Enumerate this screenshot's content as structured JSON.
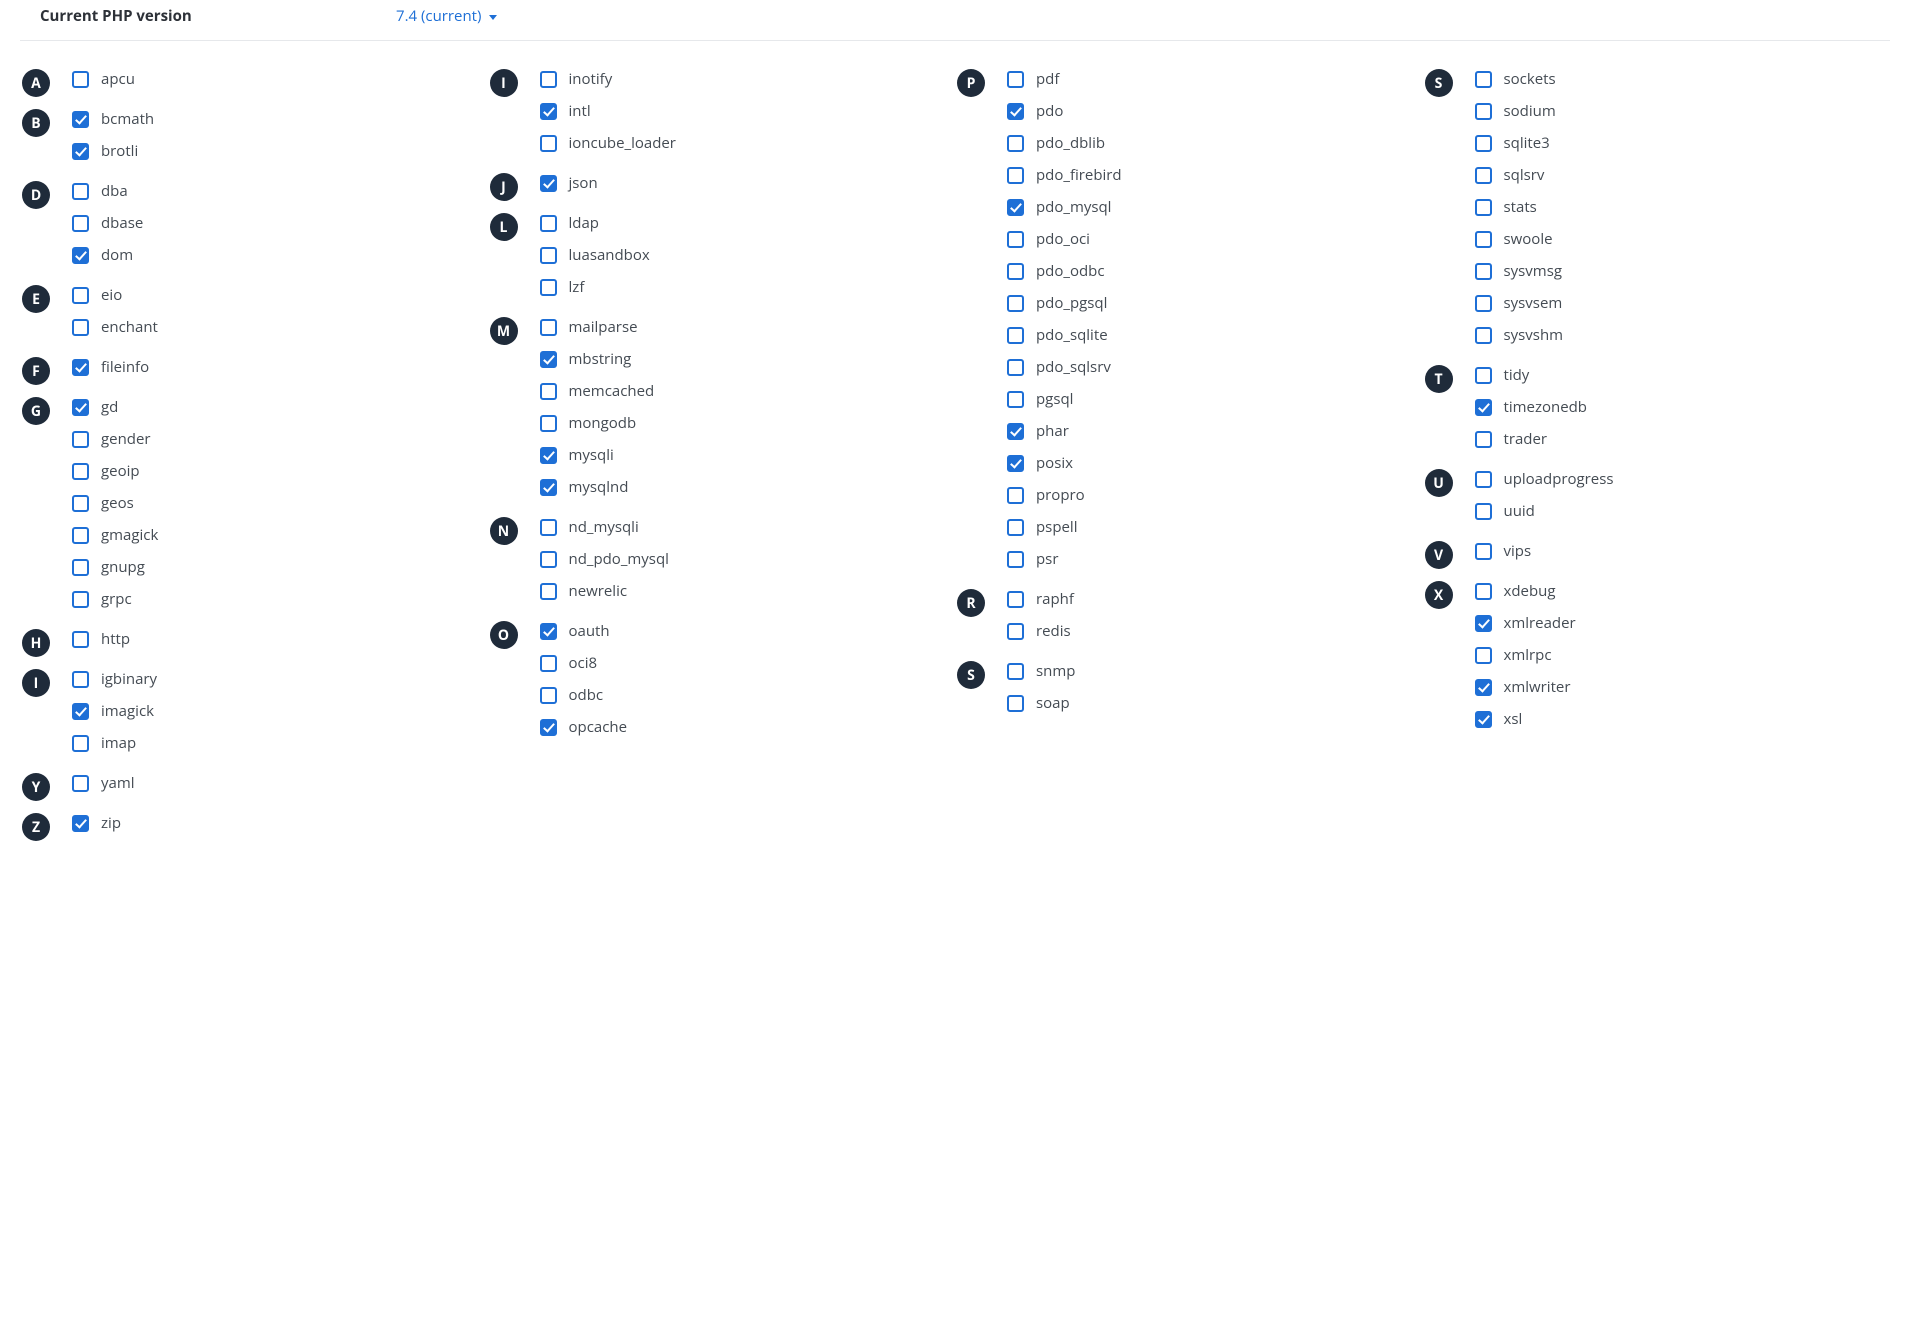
{
  "header": {
    "label": "Current PHP version",
    "version": "7.4 (current)"
  },
  "columns": [
    [
      {
        "letter": "A",
        "items": [
          {
            "name": "apcu",
            "checked": false
          }
        ]
      },
      {
        "letter": "B",
        "items": [
          {
            "name": "bcmath",
            "checked": true
          },
          {
            "name": "brotli",
            "checked": true
          }
        ]
      },
      {
        "letter": "D",
        "items": [
          {
            "name": "dba",
            "checked": false
          },
          {
            "name": "dbase",
            "checked": false
          },
          {
            "name": "dom",
            "checked": true
          }
        ]
      },
      {
        "letter": "E",
        "items": [
          {
            "name": "eio",
            "checked": false
          },
          {
            "name": "enchant",
            "checked": false
          }
        ]
      },
      {
        "letter": "F",
        "items": [
          {
            "name": "fileinfo",
            "checked": true
          }
        ]
      },
      {
        "letter": "G",
        "items": [
          {
            "name": "gd",
            "checked": true
          },
          {
            "name": "gender",
            "checked": false
          },
          {
            "name": "geoip",
            "checked": false
          },
          {
            "name": "geos",
            "checked": false
          },
          {
            "name": "gmagick",
            "checked": false
          },
          {
            "name": "gnupg",
            "checked": false
          },
          {
            "name": "grpc",
            "checked": false
          }
        ]
      },
      {
        "letter": "H",
        "items": [
          {
            "name": "http",
            "checked": false
          }
        ]
      },
      {
        "letter": "I",
        "items": [
          {
            "name": "igbinary",
            "checked": false
          },
          {
            "name": "imagick",
            "checked": true
          },
          {
            "name": "imap",
            "checked": false
          }
        ]
      },
      {
        "letter": "Y",
        "items": [
          {
            "name": "yaml",
            "checked": false
          }
        ]
      },
      {
        "letter": "Z",
        "items": [
          {
            "name": "zip",
            "checked": true
          }
        ]
      }
    ],
    [
      {
        "letter": "I",
        "items": [
          {
            "name": "inotify",
            "checked": false
          },
          {
            "name": "intl",
            "checked": true
          },
          {
            "name": "ioncube_loader",
            "checked": false
          }
        ]
      },
      {
        "letter": "J",
        "items": [
          {
            "name": "json",
            "checked": true
          }
        ]
      },
      {
        "letter": "L",
        "items": [
          {
            "name": "ldap",
            "checked": false
          },
          {
            "name": "luasandbox",
            "checked": false
          },
          {
            "name": "lzf",
            "checked": false
          }
        ]
      },
      {
        "letter": "M",
        "items": [
          {
            "name": "mailparse",
            "checked": false
          },
          {
            "name": "mbstring",
            "checked": true
          },
          {
            "name": "memcached",
            "checked": false
          },
          {
            "name": "mongodb",
            "checked": false
          },
          {
            "name": "mysqli",
            "checked": true
          },
          {
            "name": "mysqlnd",
            "checked": true
          }
        ]
      },
      {
        "letter": "N",
        "items": [
          {
            "name": "nd_mysqli",
            "checked": false
          },
          {
            "name": "nd_pdo_mysql",
            "checked": false
          },
          {
            "name": "newrelic",
            "checked": false
          }
        ]
      },
      {
        "letter": "O",
        "items": [
          {
            "name": "oauth",
            "checked": true
          },
          {
            "name": "oci8",
            "checked": false
          },
          {
            "name": "odbc",
            "checked": false
          },
          {
            "name": "opcache",
            "checked": true
          }
        ]
      }
    ],
    [
      {
        "letter": "P",
        "items": [
          {
            "name": "pdf",
            "checked": false
          },
          {
            "name": "pdo",
            "checked": true
          },
          {
            "name": "pdo_dblib",
            "checked": false
          },
          {
            "name": "pdo_firebird",
            "checked": false
          },
          {
            "name": "pdo_mysql",
            "checked": true
          },
          {
            "name": "pdo_oci",
            "checked": false
          },
          {
            "name": "pdo_odbc",
            "checked": false
          },
          {
            "name": "pdo_pgsql",
            "checked": false
          },
          {
            "name": "pdo_sqlite",
            "checked": false
          },
          {
            "name": "pdo_sqlsrv",
            "checked": false
          },
          {
            "name": "pgsql",
            "checked": false
          },
          {
            "name": "phar",
            "checked": true
          },
          {
            "name": "posix",
            "checked": true
          },
          {
            "name": "propro",
            "checked": false
          },
          {
            "name": "pspell",
            "checked": false
          },
          {
            "name": "psr",
            "checked": false
          }
        ]
      },
      {
        "letter": "R",
        "items": [
          {
            "name": "raphf",
            "checked": false
          },
          {
            "name": "redis",
            "checked": false
          }
        ]
      },
      {
        "letter": "S",
        "items": [
          {
            "name": "snmp",
            "checked": false
          },
          {
            "name": "soap",
            "checked": false
          }
        ]
      }
    ],
    [
      {
        "letter": "S",
        "items": [
          {
            "name": "sockets",
            "checked": false
          },
          {
            "name": "sodium",
            "checked": false
          },
          {
            "name": "sqlite3",
            "checked": false
          },
          {
            "name": "sqlsrv",
            "checked": false
          },
          {
            "name": "stats",
            "checked": false
          },
          {
            "name": "swoole",
            "checked": false
          },
          {
            "name": "sysvmsg",
            "checked": false
          },
          {
            "name": "sysvsem",
            "checked": false
          },
          {
            "name": "sysvshm",
            "checked": false
          }
        ]
      },
      {
        "letter": "T",
        "items": [
          {
            "name": "tidy",
            "checked": false
          },
          {
            "name": "timezonedb",
            "checked": true
          },
          {
            "name": "trader",
            "checked": false
          }
        ]
      },
      {
        "letter": "U",
        "items": [
          {
            "name": "uploadprogress",
            "checked": false
          },
          {
            "name": "uuid",
            "checked": false
          }
        ]
      },
      {
        "letter": "V",
        "items": [
          {
            "name": "vips",
            "checked": false
          }
        ]
      },
      {
        "letter": "X",
        "items": [
          {
            "name": "xdebug",
            "checked": false
          },
          {
            "name": "xmlreader",
            "checked": true
          },
          {
            "name": "xmlrpc",
            "checked": false
          },
          {
            "name": "xmlwriter",
            "checked": true
          },
          {
            "name": "xsl",
            "checked": true
          }
        ]
      }
    ]
  ]
}
